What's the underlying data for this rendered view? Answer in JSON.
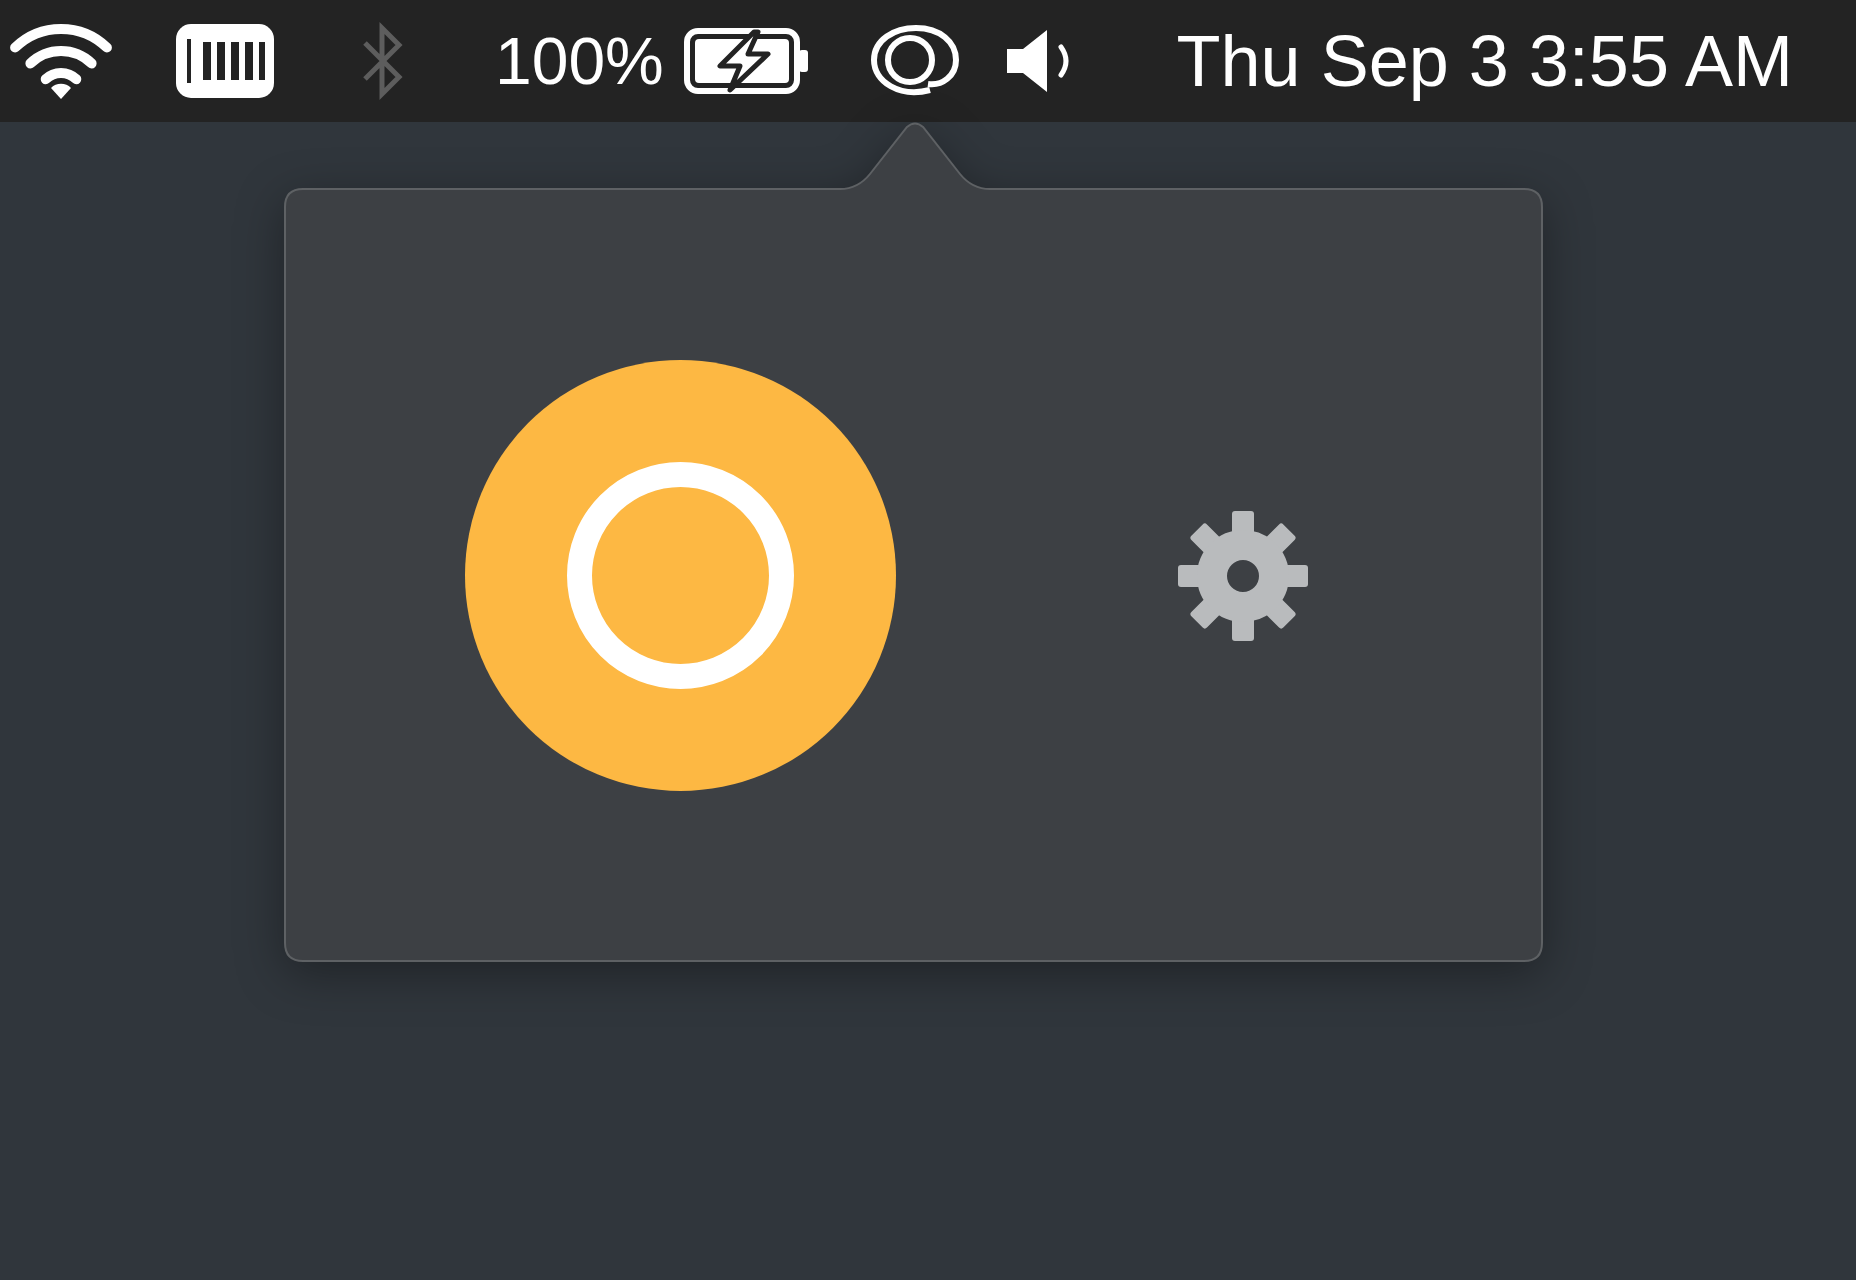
{
  "menu_bar": {
    "items": [
      {
        "kind": "wifi"
      },
      {
        "kind": "memory"
      },
      {
        "kind": "bluetooth",
        "on": false
      },
      {
        "kind": "battery",
        "percent": "100%",
        "charging": true
      },
      {
        "kind": "app"
      },
      {
        "kind": "volume"
      }
    ],
    "clock": "Thu Sep 3 3:55 AM"
  },
  "popover": {
    "buttons": [
      {
        "kind": "record"
      },
      {
        "kind": "settings"
      }
    ]
  }
}
